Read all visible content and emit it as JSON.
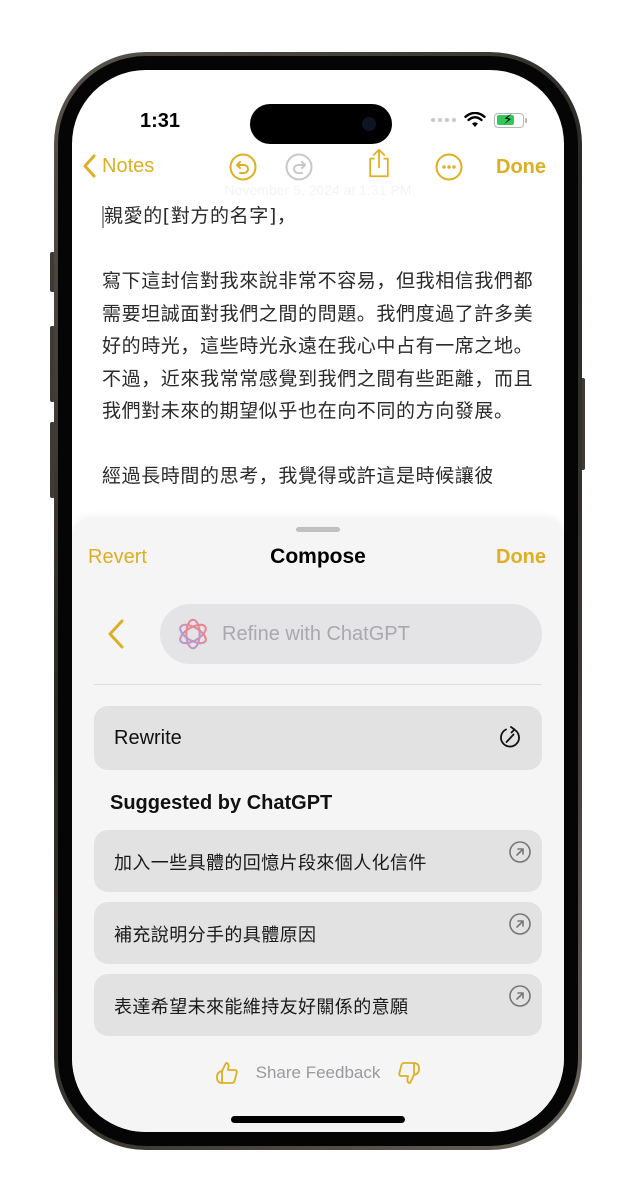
{
  "status_bar": {
    "time": "1:31"
  },
  "toolbar": {
    "back_label": "Notes",
    "done_label": "Done",
    "icons": [
      "chevron-left-icon",
      "undo-icon",
      "redo-icon",
      "share-icon",
      "more-icon"
    ]
  },
  "note": {
    "faint_date": "November 5, 2024 at 1:31 PM",
    "greeting": "親愛的[對方的名字]，",
    "paragraph_1": "寫下這封信對我來說非常不容易，但我相信我們都需要坦誠面對我們之間的問題。我們度過了許多美好的時光，這些時光永遠在我心中占有一席之地。不過，近來我常常感覺到我們之間有些距離，而且我們對未來的期望似乎也在向不同的方向發展。",
    "paragraph_2": "經過長時間的思考，我覺得或許這是時候讓彼"
  },
  "compose": {
    "revert_label": "Revert",
    "title": "Compose",
    "done_label": "Done",
    "refine_placeholder": "Refine with ChatGPT",
    "rewrite_label": "Rewrite",
    "suggested_heading": "Suggested by ChatGPT",
    "suggestions": [
      {
        "text": "加入一些具體的回憶片段來個人化信件"
      },
      {
        "text": "補充說明分手的具體原因"
      },
      {
        "text": "表達希望未來能維持友好關係的意願"
      }
    ],
    "feedback_label": "Share Feedback"
  },
  "colors": {
    "accent": "#DDAF22",
    "sheet_bg": "#f5f5f5",
    "card_bg": "#e2e2e2"
  }
}
